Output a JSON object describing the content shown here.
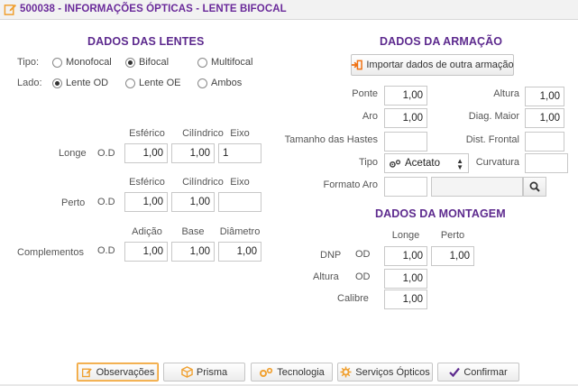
{
  "window": {
    "title": "500038 - INFORMAÇÕES ÓPTICAS - LENTE BIFOCAL"
  },
  "lentes": {
    "title": "DADOS DAS LENTES",
    "tipo": {
      "label": "Tipo:",
      "options": [
        {
          "label": "Monofocal",
          "checked": false
        },
        {
          "label": "Bifocal",
          "checked": true
        },
        {
          "label": "Multifocal",
          "checked": false
        }
      ]
    },
    "lado": {
      "label": "Lado:",
      "options": [
        {
          "label": "Lente OD",
          "checked": true
        },
        {
          "label": "Lente OE",
          "checked": false
        },
        {
          "label": "Ambos",
          "checked": false
        }
      ]
    },
    "longe": {
      "row_label": "Longe",
      "eye": "O.D",
      "headers": [
        "Esférico",
        "Cilíndrico",
        "Eixo"
      ],
      "values": [
        "1,00",
        "1,00",
        "1"
      ]
    },
    "perto": {
      "row_label": "Perto",
      "eye": "O.D",
      "headers": [
        "Esférico",
        "Cilíndrico",
        "Eixo"
      ],
      "values": [
        "1,00",
        "1,00",
        ""
      ]
    },
    "complementos": {
      "row_label": "Complementos",
      "eye": "O.D",
      "headers": [
        "Adição",
        "Base",
        "Diâmetro"
      ],
      "values": [
        "1,00",
        "1,00",
        "1,00"
      ]
    }
  },
  "armacao": {
    "title": "DADOS DA ARMAÇÃO",
    "import_label": "Importar dados de outra armação",
    "ponte": {
      "label": "Ponte",
      "value": "1,00"
    },
    "aro": {
      "label": "Aro",
      "value": "1,00"
    },
    "tamanho_hastes": {
      "label": "Tamanho das Hastes",
      "value": ""
    },
    "tipo": {
      "label": "Tipo",
      "value": "Acetato"
    },
    "formato_aro": {
      "label": "Formato Aro",
      "value": "",
      "desc_value": ""
    },
    "altura": {
      "label": "Altura",
      "value": "1,00"
    },
    "diag_maior": {
      "label": "Diag. Maior",
      "value": "1,00"
    },
    "dist_frontal": {
      "label": "Dist. Frontal",
      "value": ""
    },
    "curvatura": {
      "label": "Curvatura",
      "value": ""
    }
  },
  "montagem": {
    "title": "DADOS DA MONTAGEM",
    "col_longe": "Longe",
    "col_perto": "Perto",
    "dnp": {
      "label": "DNP",
      "eye": "OD",
      "longe": "1,00",
      "perto": "1,00"
    },
    "altura": {
      "label": "Altura",
      "eye": "OD",
      "longe": "1,00"
    },
    "calibre": {
      "label": "Calibre",
      "value": "1,00"
    }
  },
  "footer": {
    "observacoes": "Observações",
    "prisma": "Prisma",
    "tecnologia": "Tecnologia",
    "servicos": "Serviços Ópticos",
    "confirmar": "Confirmar"
  },
  "colors": {
    "title": "#5d2a8e",
    "accent": "#f0a030"
  }
}
